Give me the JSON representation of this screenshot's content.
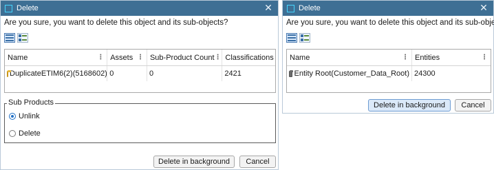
{
  "dialog1": {
    "title": "Delete",
    "question": "Are you sure, you want to delete this object and its sub-objects?",
    "columns": [
      "Name",
      "Assets",
      "Sub-Product Count",
      "Classifications"
    ],
    "row": {
      "name": "DuplicateETIM6(2)(5168602)",
      "assets": "0",
      "sub_product_count": "0",
      "classifications": "2421"
    },
    "sub_products": {
      "legend": "Sub Products",
      "options": [
        "Unlink",
        "Delete"
      ],
      "selected": "Unlink"
    },
    "buttons": {
      "delete_background": "Delete in background",
      "cancel": "Cancel"
    }
  },
  "dialog2": {
    "title": "Delete",
    "question": "Are you sure, you want to delete this object and its sub-objects?",
    "columns": [
      "Name",
      "Entities"
    ],
    "row": {
      "name": "Entity Root(Customer_Data_Root)",
      "entities": "24300"
    },
    "buttons": {
      "delete_background": "Delete in background",
      "cancel": "Cancel"
    }
  },
  "colors": {
    "titlebar": "#3e6f94",
    "accent": "#1f6fc6",
    "folder_product": "#e8b93b",
    "folder_entity": "#6b6b6b"
  },
  "icons": {
    "close": "close-icon",
    "list_view": "list-view-icon",
    "detail_view": "detail-view-icon",
    "column_menu": "column-menu-icon"
  }
}
